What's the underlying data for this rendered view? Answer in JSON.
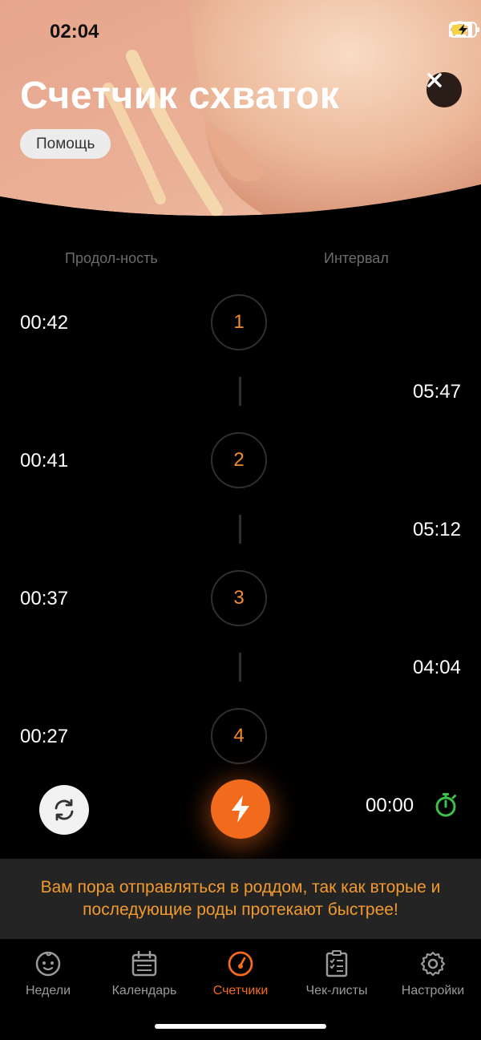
{
  "status": {
    "time": "02:04"
  },
  "header": {
    "title": "Счетчик схваток",
    "help_label": "Помощь"
  },
  "columns": {
    "duration": "Продол-ность",
    "interval": "Интервал"
  },
  "contractions": [
    {
      "number": "1",
      "duration": "00:42",
      "interval": "05:47"
    },
    {
      "number": "2",
      "duration": "00:41",
      "interval": "05:12"
    },
    {
      "number": "3",
      "duration": "00:37",
      "interval": "04:04"
    },
    {
      "number": "4",
      "duration": "00:27"
    }
  ],
  "controls": {
    "timer": "00:00"
  },
  "notice": "Вам пора отправляться в роддом, так как вторые и последующие роды протекают быстрее!",
  "tabs": [
    {
      "label": "Недели",
      "icon": "baby-face-icon"
    },
    {
      "label": "Календарь",
      "icon": "calendar-icon"
    },
    {
      "label": "Счетчики",
      "icon": "gauge-icon",
      "active": true
    },
    {
      "label": "Чек-листы",
      "icon": "checklist-icon"
    },
    {
      "label": "Настройки",
      "icon": "gear-icon"
    }
  ],
  "colors": {
    "accent": "#f26b1d",
    "number": "#f28a2e",
    "notice": "#f29a2e",
    "stopwatch": "#3fbf4a"
  }
}
